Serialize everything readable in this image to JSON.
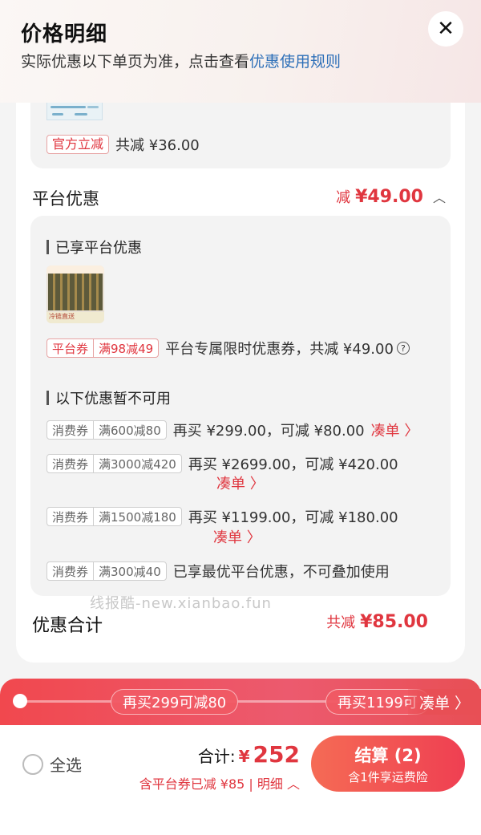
{
  "header": {
    "title": "价格明细",
    "subtitle_prefix": "实际优惠以下单页为准，点击查看",
    "subtitle_link": "优惠使用规则",
    "close_icon": "✕"
  },
  "official": {
    "tag": "官方立减",
    "text": "共减 ¥36.00"
  },
  "platform": {
    "title": "平台优惠",
    "amount_prefix": "减",
    "amount": "¥49.00",
    "chevron": "︿",
    "enjoyed_label": "已享平台优惠",
    "product_thumb_text": "冷链直送",
    "coupon_tag_a": "平台券",
    "coupon_tag_b": "满98减49",
    "coupon_text": "平台专属限时优惠券，共减 ¥49.00",
    "help_icon": "?",
    "unavailable_label": "以下优惠暂不可用",
    "unavailable": [
      {
        "tag_a": "消费券",
        "tag_b": "满600减80",
        "text": "再买 ¥299.00，可减 ¥80.00",
        "action": "凑单 〉"
      },
      {
        "tag_a": "消费券",
        "tag_b": "满3000减420",
        "text": "再买 ¥2699.00，可减 ¥420.00",
        "action": "凑单 〉"
      },
      {
        "tag_a": "消费券",
        "tag_b": "满1500减180",
        "text": "再买 ¥1199.00，可减 ¥180.00",
        "action": "凑单 〉"
      },
      {
        "tag_a": "消费券",
        "tag_b": "满300减40",
        "text": "已享最优平台优惠，不可叠加使用",
        "action": ""
      }
    ]
  },
  "total": {
    "label": "优惠合计",
    "prefix": "共减",
    "amount": "¥85.00"
  },
  "watermark": "线报酷-new.xianbao.fun",
  "promo_band": {
    "pill1": "再买299可减80",
    "pill2": "再买1199可",
    "action": "凑单 〉"
  },
  "footer": {
    "select_all": "全选",
    "sum_label": "合计:",
    "currency": "¥",
    "sum_value": "252",
    "sum_sub": "含平台券已减 ¥85 | 明细 ︿",
    "checkout_label": "结算 (2)",
    "checkout_sub": "含1件享运费险"
  },
  "colors": {
    "accent_red": "#e0363f",
    "link_blue": "#2d6fb8"
  }
}
